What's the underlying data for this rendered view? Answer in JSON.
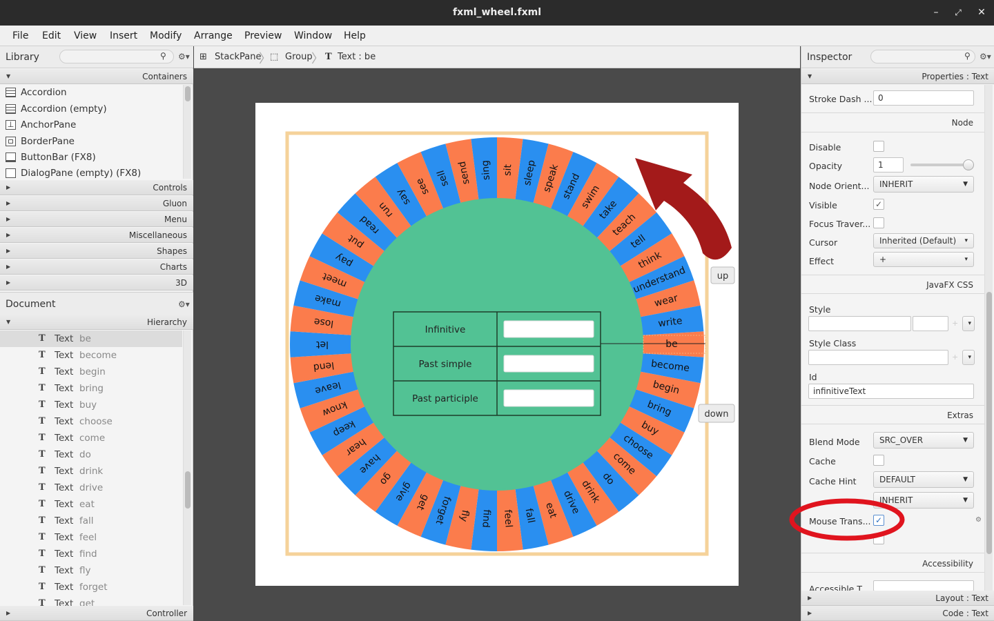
{
  "window": {
    "title": "fxml_wheel.fxml"
  },
  "menu": [
    "File",
    "Edit",
    "View",
    "Insert",
    "Modify",
    "Arrange",
    "Preview",
    "Window",
    "Help"
  ],
  "library": {
    "title": "Library",
    "containers_label": "Containers",
    "items": [
      "Accordion",
      "Accordion  (empty)",
      "AnchorPane",
      "BorderPane",
      "ButtonBar  (FX8)",
      "DialogPane (empty)  (FX8)"
    ],
    "sections": [
      "Controls",
      "Gluon",
      "Menu",
      "Miscellaneous",
      "Shapes",
      "Charts",
      "3D"
    ]
  },
  "document": {
    "title": "Document",
    "hierarchy_label": "Hierarchy",
    "node_type": "Text",
    "rows": [
      "be",
      "become",
      "begin",
      "bring",
      "buy",
      "choose",
      "come",
      "do",
      "drink",
      "drive",
      "eat",
      "fall",
      "feel",
      "find",
      "fly",
      "forget",
      "get"
    ],
    "controller_label": "Controller"
  },
  "breadcrumb": [
    "StackPane",
    "Group",
    "Text : be"
  ],
  "wheel": {
    "words": [
      "be",
      "become",
      "begin",
      "bring",
      "buy",
      "choose",
      "come",
      "do",
      "drink",
      "drive",
      "eat",
      "fall",
      "feel",
      "find",
      "fly",
      "forget",
      "get",
      "give",
      "go",
      "have",
      "hear",
      "keep",
      "know",
      "leave",
      "lend",
      "let",
      "lose",
      "make",
      "meet",
      "pay",
      "put",
      "read",
      "run",
      "say",
      "see",
      "sell",
      "send",
      "sing",
      "sit",
      "sleep",
      "speak",
      "stand",
      "swim",
      "take",
      "teach",
      "tell",
      "think",
      "understand",
      "wear",
      "write"
    ],
    "colors": {
      "orange": "#fb7c4c",
      "blue": "#2a8ff0",
      "green": "#52c294",
      "arrow": "#a31a1a"
    },
    "up_label": "up",
    "down_label": "down",
    "form": {
      "infinitive": "Infinitive",
      "past_simple": "Past simple",
      "past_participle": "Past participle"
    }
  },
  "inspector": {
    "title": "Inspector",
    "properties_label": "Properties : Text",
    "stroke_dash_label": "Stroke Dash ...",
    "stroke_dash_value": "0",
    "node_section": "Node",
    "disable_label": "Disable",
    "opacity_label": "Opacity",
    "opacity_value": "1",
    "node_orient_label": "Node Orient...",
    "node_orient_value": "INHERIT",
    "visible_label": "Visible",
    "focus_label": "Focus Traver...",
    "cursor_label": "Cursor",
    "cursor_value": "Inherited (Default)",
    "effect_label": "Effect",
    "effect_value": "+",
    "css_section": "JavaFX CSS",
    "style_label": "Style",
    "style_class_label": "Style Class",
    "id_label": "Id",
    "id_value": "infinitiveText",
    "extras_section": "Extras",
    "blend_label": "Blend Mode",
    "blend_value": "SRC_OVER",
    "cache_label": "Cache",
    "cache_hint_label": "Cache Hint",
    "cache_hint_value": "DEFAULT",
    "depth_value": "INHERIT",
    "mouse_label": "Mouse Trans...",
    "accessibility_section": "Accessibility",
    "accessible_label": "Accessible T...",
    "layout_label": "Layout : Text",
    "code_label": "Code : Text"
  }
}
